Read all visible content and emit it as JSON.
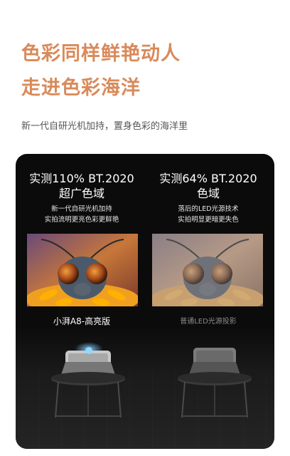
{
  "headline": {
    "line1": "色彩同样鲜艳动人",
    "line2": "走进色彩海洋"
  },
  "subtitle": "新一代自研光机加持，置身色彩的海洋里",
  "left_column": {
    "title_line1": "实测110% BT.2020",
    "title_line2": "超广色域",
    "desc_line1": "新一代自研光机加持",
    "desc_line2": "实拍流明更亮色彩更鲜艳",
    "caption": "小湃A8-高亮版"
  },
  "right_column": {
    "title_line1": "实测64% BT.2020",
    "title_line2": "色域",
    "desc_line1": "落后的LED光源技术",
    "desc_line2": "实拍明显更暗更失色",
    "caption": "普通LED光源投影"
  },
  "colors": {
    "accent": "#d98a5a",
    "panel_bg": "#0b0b0b"
  }
}
